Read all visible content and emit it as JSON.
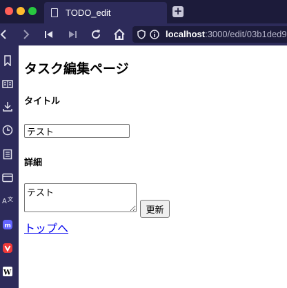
{
  "browser": {
    "tab_title": "TODO_edit",
    "url_host": "localhost",
    "url_path": ":3000/edit/03b1ded9"
  },
  "page": {
    "heading": "タスク編集ページ",
    "title_label": "タイトル",
    "title_value": "テスト",
    "detail_label": "詳細",
    "detail_value": "テスト",
    "update_button": "更新",
    "back_link": "トップへ"
  },
  "colors": {
    "titlebar_bg": "#1c1b3a",
    "toolbar_bg": "#2d2b5a",
    "link": "#0000ee",
    "mastodon": "#6364ff",
    "vivaldi": "#ef3939"
  },
  "sidebar_icons": [
    "bookmark-icon",
    "reading-list-icon",
    "downloads-icon",
    "history-icon",
    "notes-icon",
    "window-icon",
    "translate-icon",
    "mastodon-icon",
    "vivaldi-icon",
    "wikipedia-icon"
  ]
}
